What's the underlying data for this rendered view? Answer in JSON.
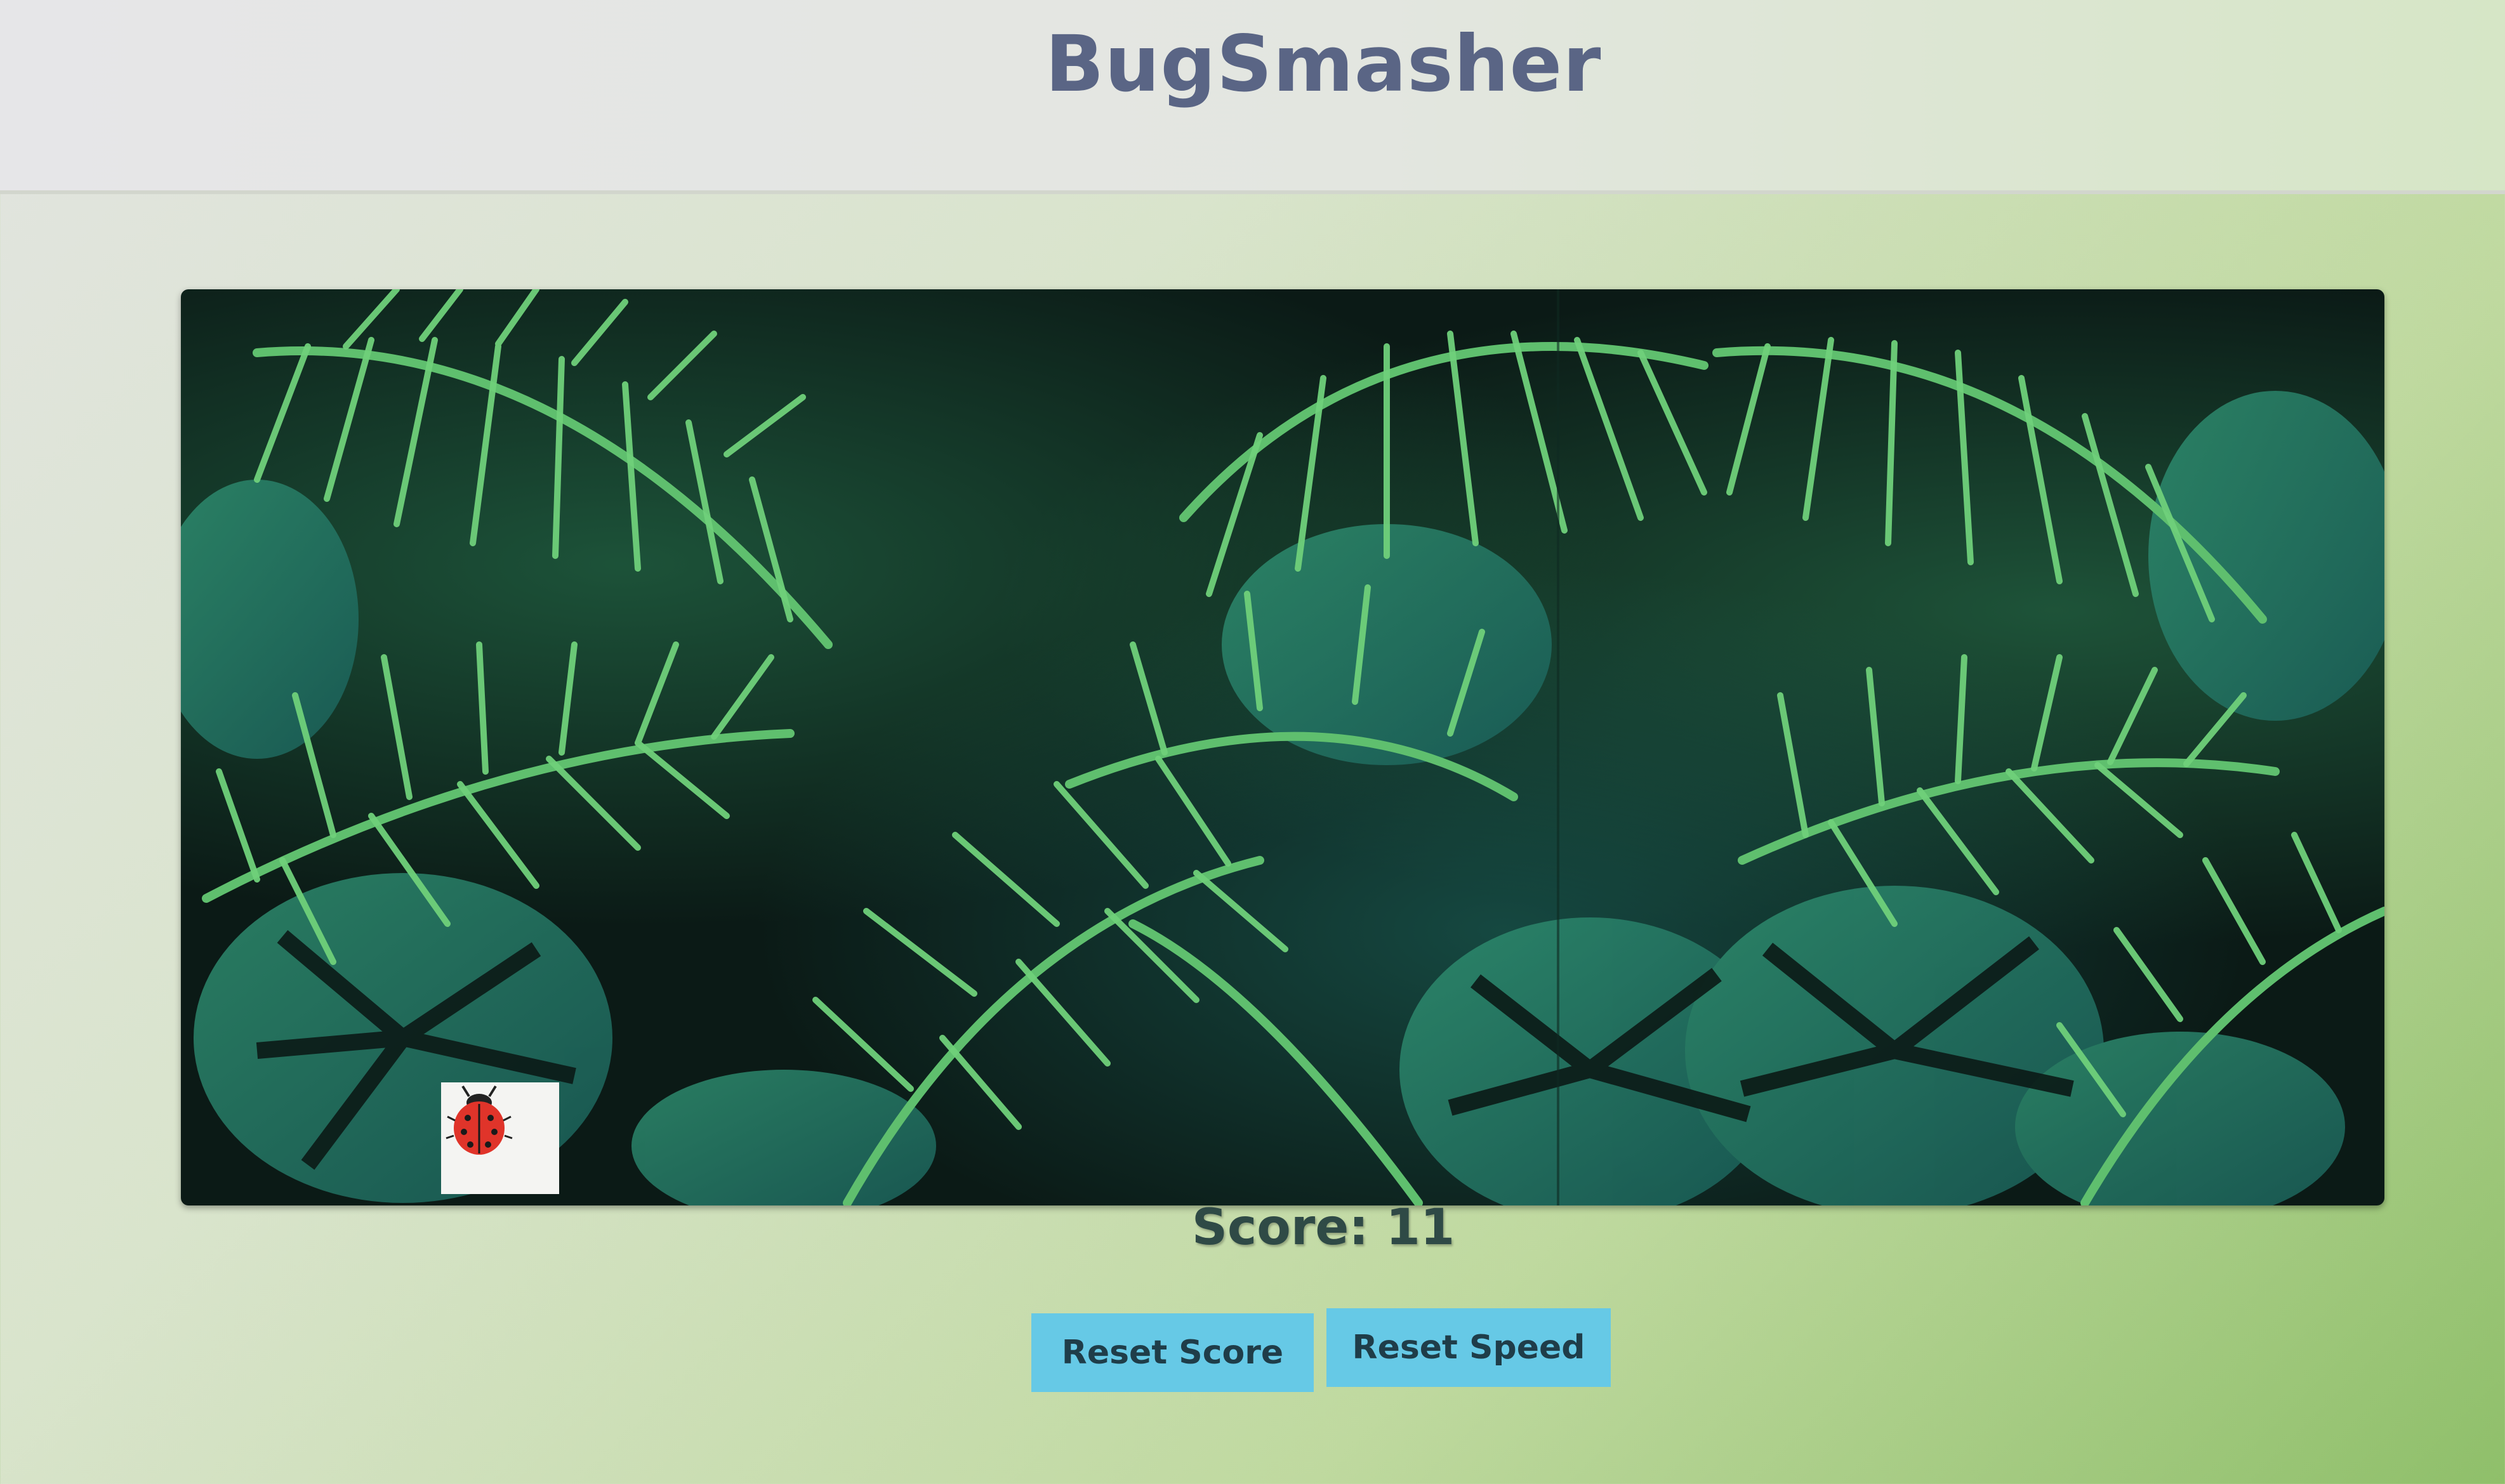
{
  "app": {
    "title": "BugSmasher"
  },
  "game": {
    "background": "tropical-palm-leaves",
    "bug_icon": "ladybug-icon",
    "bug_color": "#e0342a"
  },
  "score": {
    "text": "Score: 11"
  },
  "controls": {
    "reset_score_label": "Reset Score",
    "reset_speed_label": "Reset Speed",
    "button_color": "#66c9e6"
  }
}
